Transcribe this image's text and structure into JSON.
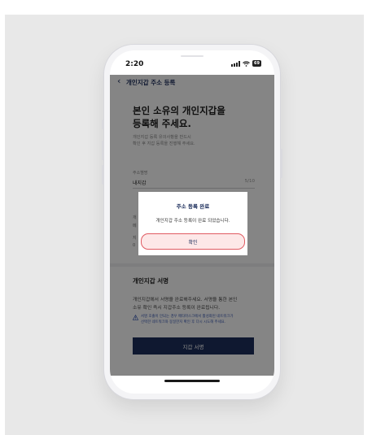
{
  "status_bar": {
    "time": "2:20",
    "battery": "69"
  },
  "nav": {
    "back_icon": "chevron-left-icon",
    "title": "개인지갑 주소 등록"
  },
  "headline": {
    "line1": "본인 소유의 개인지갑을",
    "line2": "등록해 주세요."
  },
  "subtext": {
    "line1": "개인지갑 등록 유의사항을 반드시",
    "line2": "확인 후 지갑 등록을 진행해 주세요."
  },
  "address_name": {
    "label": "주소별명",
    "value": "내지갑",
    "counter": "5/10"
  },
  "signature": {
    "title": "개인지갑 서명",
    "desc_line1": "개인지갑에서 서명을 완료해주세요. 서명을 통한 본인",
    "desc_line2": "소유 확인 즉시 지갑주소 등록이 완료됩니다.",
    "warning_line1": "서명 호출이 안되는 경우 메타마스크에서 활성화된 네트워크가",
    "warning_line2": "선택한 네트워크와 동일한지 확인 후 다시 시도해 주세요.",
    "button_label": "지갑 서명"
  },
  "modal": {
    "title": "주소 등록 완료",
    "message": "개인지갑 주소 등록이 완료 되었습니다.",
    "confirm_label": "확인"
  },
  "colors": {
    "brand_navy": "#1d2f5c",
    "highlight_red": "#e05b62",
    "highlight_fill": "#fde8e8",
    "warning_blue": "#3b5bb5"
  }
}
